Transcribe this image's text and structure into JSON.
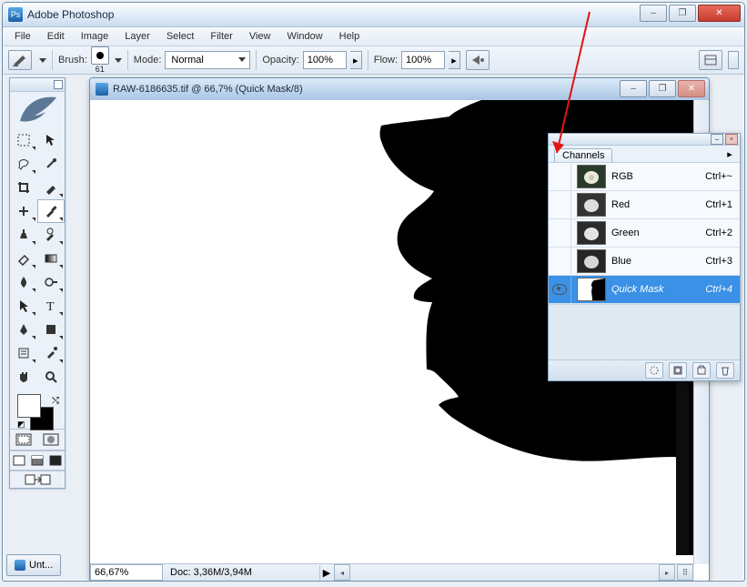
{
  "app": {
    "title": "Adobe Photoshop",
    "icon_letter": "Ps"
  },
  "win_controls": {
    "min": "–",
    "max": "❐",
    "close": "✕"
  },
  "menu": [
    "File",
    "Edit",
    "Image",
    "Layer",
    "Select",
    "Filter",
    "View",
    "Window",
    "Help"
  ],
  "options_bar": {
    "brush_label": "Brush:",
    "brush_size": "61",
    "mode_label": "Mode:",
    "mode_value": "Normal",
    "opacity_label": "Opacity:",
    "opacity_value": "100%",
    "flow_label": "Flow:",
    "flow_value": "100%"
  },
  "document": {
    "title": "RAW-6186635.tif @ 66,7% (Quick Mask/8)",
    "zoom": "66,67%",
    "doc_sizes": "Doc: 3,36M/3,94M"
  },
  "channels_panel": {
    "tab": "Channels",
    "rows": [
      {
        "name": "RGB",
        "shortcut": "Ctrl+~",
        "visible": false,
        "selected": false,
        "thumb": "photo"
      },
      {
        "name": "Red",
        "shortcut": "Ctrl+1",
        "visible": false,
        "selected": false,
        "thumb": "photo"
      },
      {
        "name": "Green",
        "shortcut": "Ctrl+2",
        "visible": false,
        "selected": false,
        "thumb": "photo"
      },
      {
        "name": "Blue",
        "shortcut": "Ctrl+3",
        "visible": false,
        "selected": false,
        "thumb": "photo"
      },
      {
        "name": "Quick Mask",
        "shortcut": "Ctrl+4",
        "visible": true,
        "selected": true,
        "thumb": "mask"
      }
    ]
  },
  "taskbar": {
    "item": "Unt..."
  },
  "toolbox": {
    "modes": {
      "standard": true,
      "quick_mask": false
    }
  }
}
